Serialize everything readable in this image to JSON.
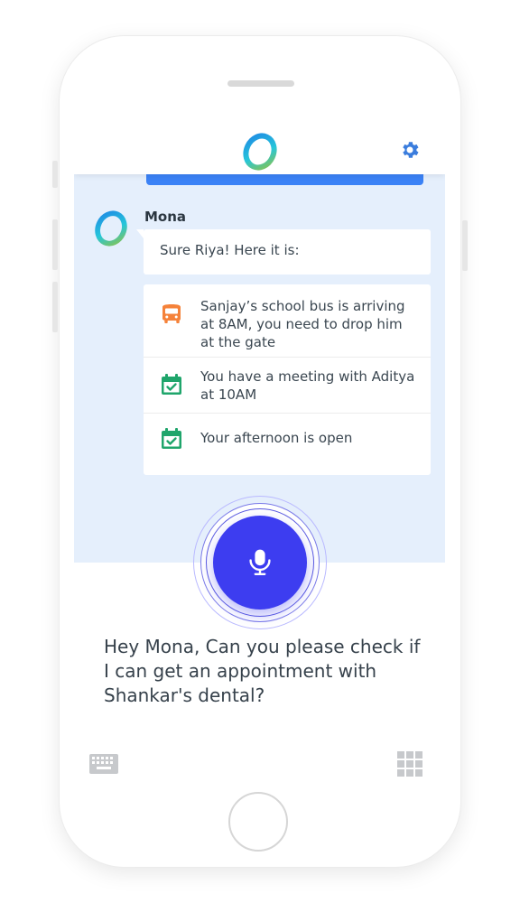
{
  "app": {
    "logo_icon": "app-logo",
    "settings_icon": "gear-icon",
    "accent_color": "#3b82f6",
    "mic_color": "#3d3df0"
  },
  "chat": {
    "sender_name": "Mona",
    "reply_text": "Sure Riya! Here it is:",
    "schedule_items": [
      {
        "icon": "bus-icon",
        "icon_color": "#f5823a",
        "text": "Sanjay’s school bus is arriving at 8AM, you need to drop him at the gate"
      },
      {
        "icon": "calendar-check-icon",
        "icon_color": "#1fa56b",
        "text": "You have a meeting with Aditya at 10AM"
      },
      {
        "icon": "calendar-check-icon",
        "icon_color": "#1fa56b",
        "text": "Your afternoon is open"
      }
    ]
  },
  "voice": {
    "mic_icon": "microphone-icon",
    "query_text": "Hey Mona, Can you please check if I can get an appointment with Shankar's dental?"
  },
  "bottom_bar": {
    "keyboard_icon": "keyboard-icon",
    "apps_icon": "grid-icon"
  }
}
